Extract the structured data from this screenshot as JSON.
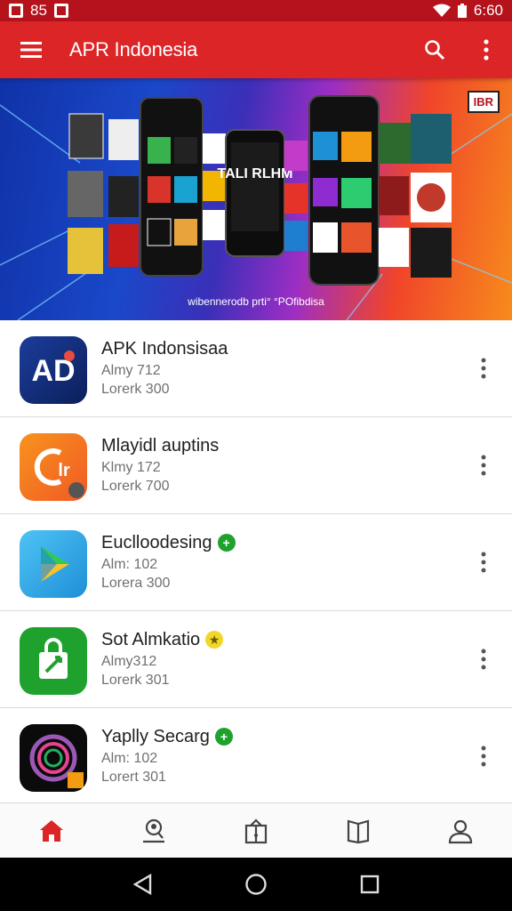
{
  "status_bar": {
    "left_text": "85",
    "time": "6:60"
  },
  "app_bar": {
    "title": "APR Indonesia"
  },
  "banner": {
    "caption": "wibennerodb prti° °POfibdisa",
    "badge": "IBR",
    "phone_text": "TALI RLHM"
  },
  "apps": [
    {
      "name": "APK Indonsisaa",
      "line1": "Almy 712",
      "line2": "Lorerk 300",
      "icon": "ad-app-icon",
      "icon_text": "AD",
      "badge": null
    },
    {
      "name": "Mlayidl auptins",
      "line1": "Klmy 172",
      "line2": "Lorerk 700",
      "icon": "orange-c-app-icon",
      "icon_text": "Cir",
      "badge": null
    },
    {
      "name": "Euclloodesing",
      "line1": "Alm: 102",
      "line2": "Lorera 300",
      "icon": "play-store-icon",
      "icon_text": "",
      "badge": {
        "type": "plus",
        "color": "#1fa12e",
        "symbol": "+"
      }
    },
    {
      "name": "Sot Almkatio",
      "line1": "Almy312",
      "line2": "Lorerk 301",
      "icon": "shopping-bag-icon",
      "icon_text": "",
      "badge": {
        "type": "star",
        "color": "#f2d72a",
        "symbol": "★"
      }
    },
    {
      "name": "Yaplly Secarg",
      "line1": "Alm: 102",
      "line2": "Lorert 301",
      "icon": "camera-ring-icon",
      "icon_text": "",
      "badge": {
        "type": "plus",
        "color": "#1fa12e",
        "symbol": "+"
      }
    }
  ],
  "bottom_nav": [
    {
      "name": "home",
      "active": true
    },
    {
      "name": "search-person",
      "active": false
    },
    {
      "name": "updates",
      "active": false
    },
    {
      "name": "library",
      "active": false
    },
    {
      "name": "account",
      "active": false
    }
  ],
  "colors": {
    "primary": "#dc2527",
    "status": "#b5121b",
    "active_nav": "#dc2527"
  }
}
